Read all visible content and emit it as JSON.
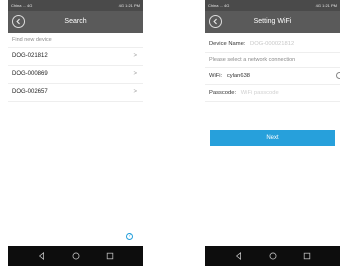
{
  "left_screen": {
    "status": {
      "left": "China ... 4G",
      "right": "4G 1:21 PM"
    },
    "title": "Search",
    "hint": "Find new device",
    "devices": [
      {
        "label": "DOG-021812"
      },
      {
        "label": "DOG-000869"
      },
      {
        "label": "DOG-002657"
      }
    ],
    "chevron": ">",
    "help_icon": "help-icon"
  },
  "right_screen": {
    "status": {
      "left": "China ... 4G",
      "right": "4G 1:21 PM"
    },
    "title": "Setting WiFi",
    "device_name_label": "Device Name:",
    "device_name_value": "DOG-000021812",
    "hint": "Please select a network connection",
    "wifi_label": "WiFi:",
    "wifi_value": "cylan638",
    "passcode_label": "Passcode:",
    "passcode_placeholder": "WiFi passcode",
    "next_label": "Next",
    "accent_color": "#27a0db"
  }
}
